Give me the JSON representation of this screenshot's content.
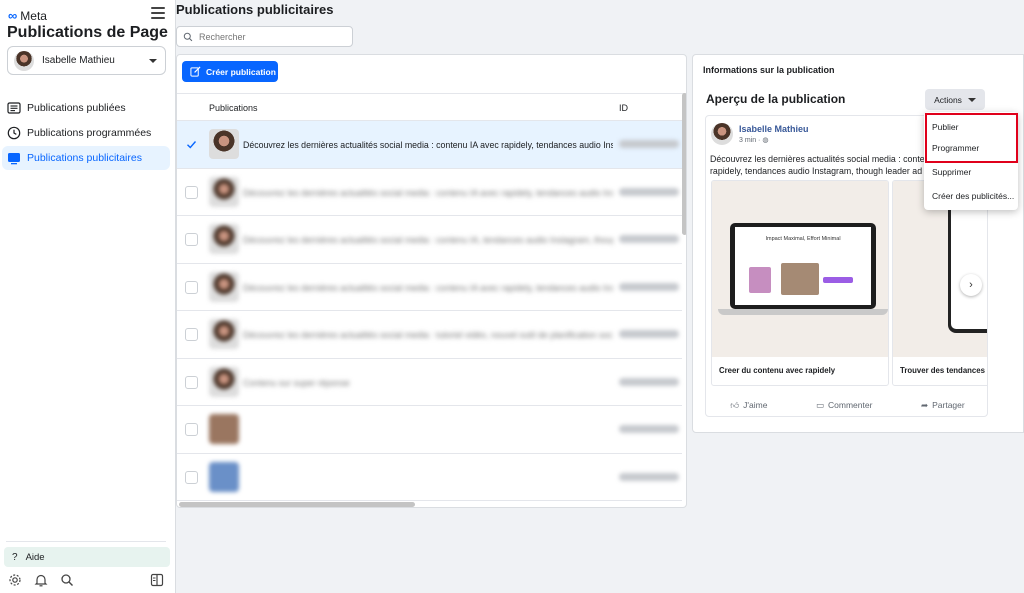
{
  "sidebar": {
    "brand": "Meta",
    "title": "Publications de Page",
    "account": "Isabelle Mathieu",
    "nav": [
      {
        "label": "Publications publiées",
        "icon": "list-icon",
        "active": false
      },
      {
        "label": "Publications programmées",
        "icon": "clock-icon",
        "active": false
      },
      {
        "label": "Publications publicitaires",
        "icon": "ad-screen-icon",
        "active": true
      }
    ],
    "help": "Aide",
    "footer_icons": [
      "gear-icon",
      "bell-icon",
      "search-icon",
      "panel-toggle-icon"
    ]
  },
  "main": {
    "title": "Publications publicitaires",
    "search_placeholder": "Rechercher",
    "create_label": "Créer publication",
    "columns": [
      "Publications",
      "ID"
    ],
    "rows": [
      {
        "text": "Découvrez les dernières actualités social media : contenu IA avec rapidely, tendances audio Instagram, though leader ad LinkedIn",
        "selected": true,
        "blurred": false
      },
      {
        "text": "Découvrez les dernières actualités social media : contenu IA avec rapidely, tendances audio Instagram",
        "selected": false,
        "blurred": true
      },
      {
        "text": "Découvrez les dernières actualités social media : contenu IA, tendances audio Instagram, though leader",
        "selected": false,
        "blurred": true
      },
      {
        "text": "Découvrez les dernières actualités social media : contenu IA avec rapidely, tendances audio Instagram",
        "selected": false,
        "blurred": true
      },
      {
        "text": "Découvrez les dernières actualités social media : tutoriel vidéo, nouvel outil de planification social",
        "selected": false,
        "blurred": true
      },
      {
        "text": "Contenu sur super réponse",
        "selected": false,
        "blurred": true
      },
      {
        "text": "",
        "selected": false,
        "blurred": true
      },
      {
        "text": "",
        "selected": false,
        "blurred": true
      }
    ]
  },
  "details": {
    "section_title": "Informations sur la publication",
    "preview_title": "Aperçu de la publication",
    "actions_label": "Actions",
    "post": {
      "author": "Isabelle Mathieu",
      "time": "3 min · ",
      "text": "Découvrez les dernières actualités social media : contenu IA avec rapidely, tendances audio Instagram, though leader ad LinkedIn",
      "cards": [
        {
          "caption": "Creer du contenu avec rapidely",
          "headline": "Impact Maximal, Effort Minimal"
        },
        {
          "caption": "Trouver des tendances audio"
        }
      ],
      "like": "J'aime",
      "comment": "Commenter",
      "share": "Partager"
    },
    "menu": [
      "Publier",
      "Programmer",
      "Supprimer",
      "Créer des publicités..."
    ]
  }
}
